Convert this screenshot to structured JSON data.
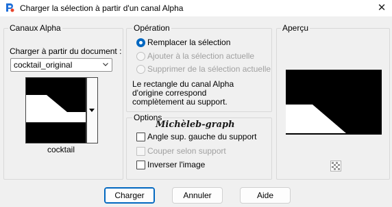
{
  "window": {
    "title": "Charger la sélection à partir d'un canal Alpha",
    "close_glyph": "✕"
  },
  "canaux": {
    "legend": "Canaux Alpha",
    "source_label": "Charger à partir du document :",
    "document_value": "cocktail_original",
    "thumbnail_caption": "cocktail"
  },
  "operation": {
    "legend": "Opération",
    "options": [
      {
        "label": "Remplacer la sélection",
        "selected": true,
        "enabled": true
      },
      {
        "label": "Ajouter à la sélection actuelle",
        "selected": false,
        "enabled": false
      },
      {
        "label": "Supprimer de la sélection actuelle",
        "selected": false,
        "enabled": false
      }
    ],
    "info": [
      "Le rectangle du canal Alpha",
      "d'origine correspond",
      "complètement au support."
    ]
  },
  "options": {
    "legend": "Options",
    "watermark": "Michèleb-graph",
    "checkboxes": [
      {
        "label": "Angle sup. gauche du support",
        "checked": false,
        "enabled": true
      },
      {
        "label": "Couper selon support",
        "checked": false,
        "enabled": false
      },
      {
        "label": "Inverser l'image",
        "checked": false,
        "enabled": true
      }
    ]
  },
  "apercu": {
    "legend": "Aperçu"
  },
  "buttons": {
    "load": "Charger",
    "cancel": "Annuler",
    "help": "Aide"
  },
  "icons": {
    "app": "paintshop-app-icon",
    "dropdown": "chevron-down-icon",
    "transparency": "checkerboard-icon"
  }
}
